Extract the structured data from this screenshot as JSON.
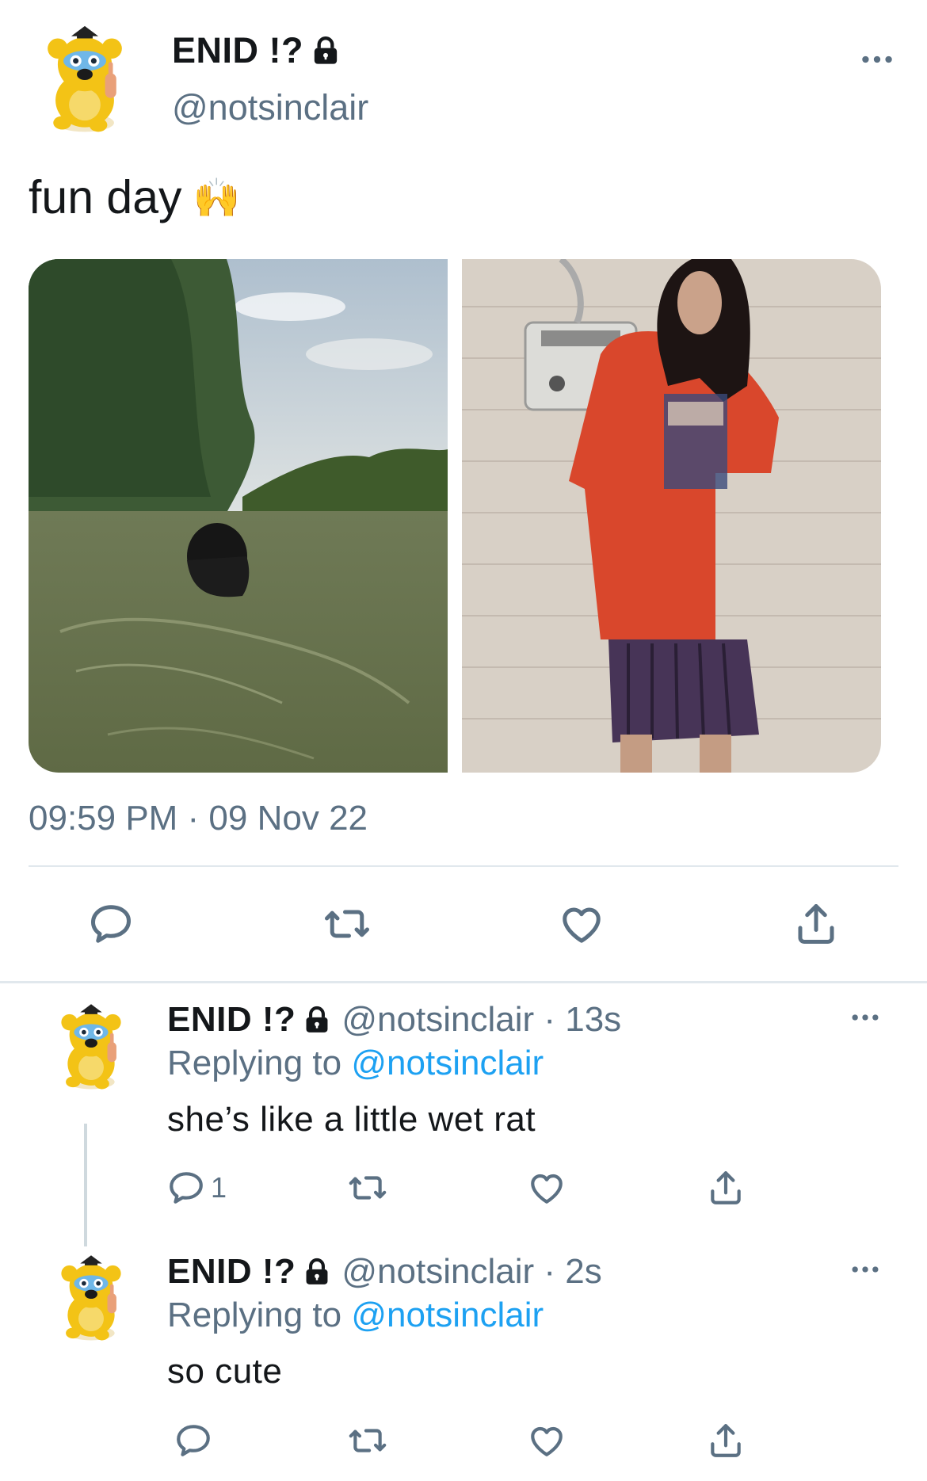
{
  "tweet": {
    "display_name": "ENID !?",
    "handle": "@notsinclair",
    "text": "fun day",
    "emoji": "🙌",
    "timestamp": "09:59 PM · 09 Nov 22",
    "media": [
      "photo of a girl swimming in a river",
      "photo of a girl in a red oversized t-shirt in a tiled restroom"
    ]
  },
  "replies": [
    {
      "display_name": "ENID !?",
      "handle_time": "@notsinclair · 13s",
      "replying_prefix": "Replying to",
      "replying_to": "@notsinclair",
      "text": "she’s like a little wet rat",
      "reply_count": "1"
    },
    {
      "display_name": "ENID !?",
      "handle_time": "@notsinclair · 2s",
      "replying_prefix": "Replying to",
      "replying_to": "@notsinclair",
      "text": "so cute",
      "reply_count": ""
    }
  ],
  "icons": {
    "lock": "lock-icon",
    "more": "more-horizontal-icon",
    "reply": "reply-icon",
    "retweet": "retweet-icon",
    "like": "heart-icon",
    "share": "share-icon"
  },
  "colors": {
    "text": "#14171a",
    "secondary": "#5b7083",
    "link": "#1da1f2",
    "divider": "#e1e8ed"
  }
}
